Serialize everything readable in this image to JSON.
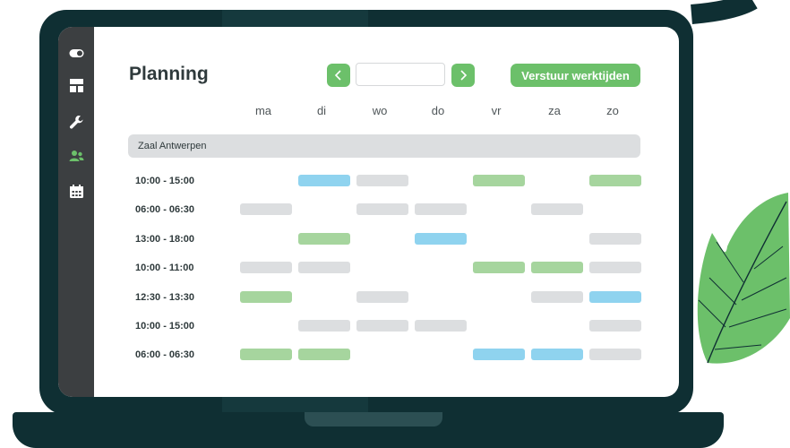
{
  "app": {
    "title": "Planning",
    "date_value": "",
    "send_label": "Verstuur werktijden"
  },
  "sidebar": {
    "icons": [
      "toggle-icon",
      "layout-icon",
      "wrench-icon",
      "users-icon",
      "calendar-icon"
    ],
    "active": "users-icon"
  },
  "days": [
    "ma",
    "di",
    "wo",
    "do",
    "vr",
    "za",
    "zo"
  ],
  "group": {
    "name": "Zaal Antwerpen"
  },
  "rows": [
    {
      "time": "10:00 - 15:00",
      "shifts": [
        "",
        "blue",
        "grey",
        "",
        "green",
        "",
        "green"
      ]
    },
    {
      "time": "06:00 - 06:30",
      "shifts": [
        "grey",
        "",
        "grey",
        "grey",
        "",
        "grey",
        ""
      ]
    },
    {
      "time": "13:00 - 18:00",
      "shifts": [
        "",
        "green",
        "",
        "blue",
        "",
        "",
        "grey"
      ]
    },
    {
      "time": "10:00 - 11:00",
      "shifts": [
        "grey",
        "grey",
        "",
        "",
        "green",
        "green",
        "grey"
      ]
    },
    {
      "time": "12:30 - 13:30",
      "shifts": [
        "green",
        "",
        "grey",
        "",
        "",
        "grey",
        "blue"
      ]
    },
    {
      "time": "10:00 - 15:00",
      "shifts": [
        "",
        "grey",
        "grey",
        "grey",
        "",
        "",
        "grey"
      ]
    },
    {
      "time": "06:00 - 06:30",
      "shifts": [
        "green",
        "green",
        "",
        "",
        "blue",
        "blue",
        "grey"
      ]
    }
  ],
  "colors": {
    "accent_green": "#6cc06a",
    "shift_green": "#a6d59e",
    "shift_blue": "#8fd3ef",
    "shift_grey": "#dcdee0",
    "laptop": "#0f2f33",
    "sidebar": "#3c3f41",
    "leaf": "#6cc06a"
  }
}
